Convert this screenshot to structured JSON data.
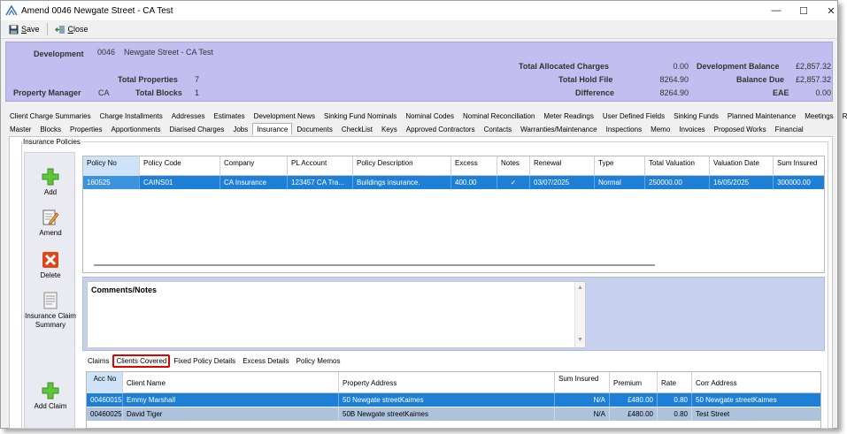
{
  "window": {
    "title": "Amend 0046 Newgate Street - CA Test",
    "minimize_glyph": "—",
    "maximize_glyph": "☐",
    "close_glyph": "✕"
  },
  "toolbar": {
    "save_label": "ave",
    "save_key": "S",
    "close_label": "lose",
    "close_key": "C"
  },
  "header": {
    "development_label": "Development",
    "development_code": "0046",
    "development_name": "Newgate Street - CA Test",
    "total_properties_label": "Total Properties",
    "total_properties_value": "7",
    "property_manager_label": "Property Manager",
    "property_manager_value": "CA",
    "total_blocks_label": "Total Blocks",
    "total_blocks_value": "1",
    "total_allocated_charges_label": "Total Allocated Charges",
    "total_allocated_charges_value": "0.00",
    "total_hold_file_label": "Total Hold File",
    "total_hold_file_value": "8264.90",
    "difference_label": "Difference",
    "difference_value": "8264.90",
    "development_balance_label": "Development Balance",
    "development_balance_value": "£2,857.32",
    "balance_due_label": "Balance Due",
    "balance_due_value": "£2,857.32",
    "eae_label": "EAE",
    "eae_value": "0.00"
  },
  "tabs_row1": [
    "Client Charge Summaries",
    "Charge Installments",
    "Addresses",
    "Estimates",
    "Development News",
    "Sinking Fund Nominals",
    "Nominal Codes",
    "Nominal Reconciliation",
    "Meter Readings",
    "User Defined Fields",
    "Sinking Funds",
    "Planned Maintenance",
    "Meetings",
    "Roles"
  ],
  "tabs_row2": [
    "Master",
    "Blocks",
    "Properties",
    "Apportionments",
    "Diarised Charges",
    "Jobs",
    "Insurance",
    "Documents",
    "CheckList",
    "Keys",
    "Approved Contractors",
    "Contacts",
    "Warranties/Maintenance",
    "Inspections",
    "Memo",
    "Invoices",
    "Proposed Works",
    "Financial"
  ],
  "active_tab": "Insurance",
  "insurance_group_label": "Insurance Policies",
  "side_buttons": {
    "add": "Add",
    "amend": "Amend",
    "delete": "Delete",
    "claim_summary": "Insurance Claim Summary",
    "add_claim": "Add Claim"
  },
  "policies": {
    "columns": [
      "Policy No",
      "Policy Code",
      "Company",
      "PL Account",
      "Policy Description",
      "Excess",
      "Notes",
      "Renewal",
      "Type",
      "Total Valuation",
      "Valuation Date",
      "Sum Insured"
    ],
    "rows": [
      {
        "policy_no": "160525",
        "policy_code": "CAINS01",
        "company": "CA Insurance",
        "pl_account": "123457   CA Tra...",
        "description": "Buildings insurance.",
        "excess": "400.00",
        "notes": "✓",
        "renewal": "03/07/2025",
        "type": "Normal",
        "total_valuation": "250000.00",
        "valuation_date": "16/05/2025",
        "sum_insured": "300000.00"
      }
    ]
  },
  "comments_title": "Comments/Notes",
  "scroll_up_glyph": "▲",
  "scroll_down_glyph": "▼",
  "sub_tabs": [
    "Claims",
    "Clients Covered",
    "Fixed Policy Details",
    "Excess Details",
    "Policy Memos"
  ],
  "active_sub_tab": "Clients Covered",
  "clients": {
    "columns": [
      "Acc No",
      "Client Name",
      "Property Address",
      "Sum Insured",
      "Premium",
      "Rate",
      "Corr Address"
    ],
    "rows": [
      {
        "acc_no": "00460015",
        "client_name": "Emmy Marshall",
        "property_address": "50 Newgate streetKaimes",
        "sum_insured": "N/A",
        "premium": "£480.00",
        "rate": "0.80",
        "corr_address": "50 Newgate streetKaimes"
      },
      {
        "acc_no": "00460025",
        "client_name": "David Tiger",
        "property_address": "50B Newgate streetKaimes",
        "sum_insured": "N/A",
        "premium": "£480.00",
        "rate": "0.80",
        "corr_address": "Test Street"
      }
    ]
  },
  "colors": {
    "header_bg": "#c3bdf0",
    "selection_blue": "#1e7fd6",
    "highlight_red": "#e00000",
    "comments_bg": "#c6d2ed"
  }
}
